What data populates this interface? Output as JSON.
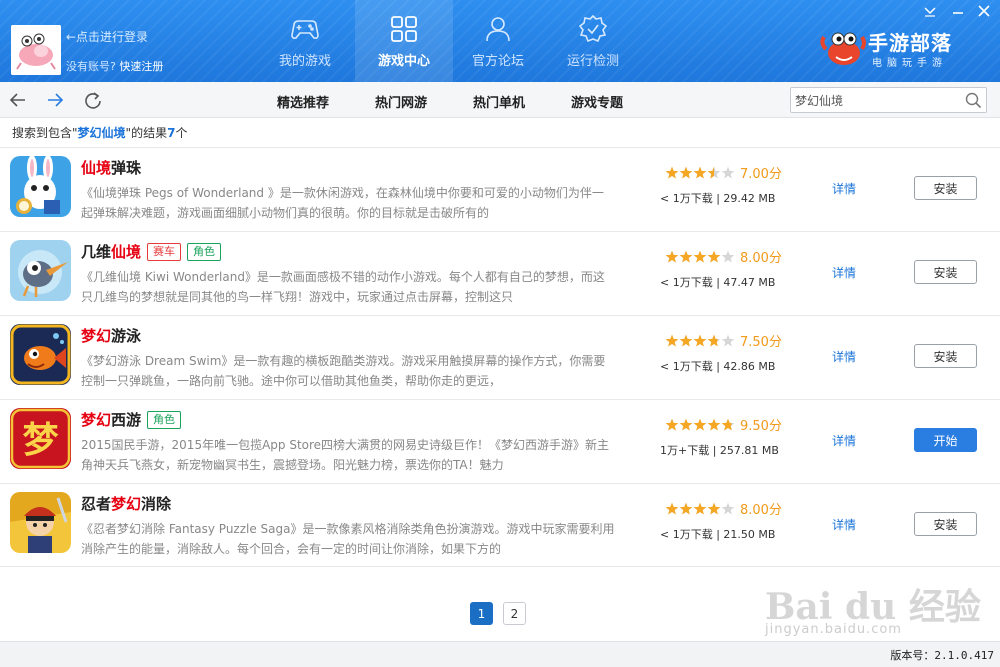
{
  "header": {
    "login_text": "←点击进行登录",
    "no_account": "没有账号?",
    "register": "快速注册",
    "nav": [
      {
        "label": "我的游戏",
        "icon": "gamepad-icon"
      },
      {
        "label": "游戏中心",
        "icon": "grid-icon"
      },
      {
        "label": "官方论坛",
        "icon": "user-icon"
      },
      {
        "label": "运行检测",
        "icon": "gear-check-icon"
      }
    ],
    "logo_text": "手游部落",
    "logo_sub": "电脑玩手游"
  },
  "toolbar": {
    "tabs": [
      "精选推荐",
      "热门网游",
      "热门单机",
      "游戏专题"
    ],
    "search_value": "梦幻仙境"
  },
  "result": {
    "prefix": "搜索到包含\"",
    "keyword": "梦幻仙境",
    "middle": "\"的结果",
    "count": "7",
    "suffix": "个"
  },
  "games": [
    {
      "title_pre": "",
      "title_hl": "仙境",
      "title_post": "弹珠",
      "tags": [],
      "desc": "《仙境弹珠 Pegs of Wonderland 》是一款休闲游戏，在森林仙境中你要和可爱的小动物们为伴一起弹珠解决难题，游戏画面细腻小动物们真的很萌。你的目标就是击破所有的",
      "rating": 3.5,
      "score": "7.00分",
      "downloads": "< 1万下载",
      "size": "29.42 MB",
      "detail": "详情",
      "action": "安装",
      "action_style": "normal"
    },
    {
      "title_pre": "几维",
      "title_hl": "仙境",
      "title_post": "",
      "tags": [
        {
          "text": "赛车",
          "color": "red"
        },
        {
          "text": "角色",
          "color": "green"
        }
      ],
      "desc": "《几维仙境 Kiwi Wonderland》是一款画面感极不错的动作小游戏。每个人都有自己的梦想，而这只几维鸟的梦想就是同其他的鸟一样飞翔！游戏中，玩家通过点击屏幕，控制这只",
      "rating": 4.0,
      "score": "8.00分",
      "downloads": "< 1万下载",
      "size": "47.47 MB",
      "detail": "详情",
      "action": "安装",
      "action_style": "normal"
    },
    {
      "title_pre": "",
      "title_hl": "梦幻",
      "title_post": "游泳",
      "tags": [],
      "desc": "《梦幻游泳 Dream Swim》是一款有趣的横板跑酷类游戏。游戏采用触摸屏幕的操作方式，你需要控制一只弹跳鱼，一路向前飞驰。途中你可以借助其他鱼类，帮助你走的更远，",
      "rating": 3.75,
      "score": "7.50分",
      "downloads": "< 1万下载",
      "size": "42.86 MB",
      "detail": "详情",
      "action": "安装",
      "action_style": "normal"
    },
    {
      "title_pre": "",
      "title_hl": "梦幻",
      "title_post": "西游",
      "tags": [
        {
          "text": "角色",
          "color": "green"
        }
      ],
      "desc": "2015国民手游，2015年唯一包揽App Store四榜大满贯的网易史诗级巨作！《梦幻西游手游》新主角神天兵飞燕女，新宠物幽冥书生，震撼登场。阳光魅力榜，票选你的TA！魅力",
      "rating": 4.75,
      "score": "9.50分",
      "downloads": "1万+下载",
      "size": "257.81 MB",
      "detail": "详情",
      "action": "开始",
      "action_style": "primary"
    },
    {
      "title_pre": "忍者",
      "title_hl": "梦幻",
      "title_post": "消除",
      "tags": [],
      "desc": "《忍者梦幻消除 Fantasy Puzzle Saga》是一款像素风格消除类角色扮演游戏。游戏中玩家需要利用消除产生的能量，消除敌人。每个回合，会有一定的时间让你消除，如果下方的",
      "rating": 4.0,
      "score": "8.00分",
      "downloads": "< 1万下载",
      "size": "21.50 MB",
      "detail": "详情",
      "action": "安装",
      "action_style": "normal"
    }
  ],
  "pager": {
    "pages": [
      "1",
      "2"
    ],
    "current": 0
  },
  "watermark": {
    "logo": "Bai du 经验",
    "url": "jingyan.baidu.com"
  },
  "footer": {
    "version": "版本号：2.1.0.417"
  },
  "colors": {
    "accent": "#1f77dc",
    "highlight": "#e60012",
    "star": "#f5a623"
  }
}
